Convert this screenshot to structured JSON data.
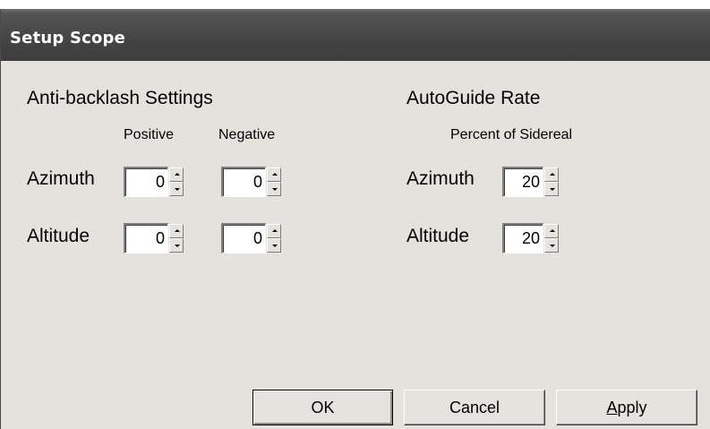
{
  "window": {
    "title": "Setup Scope"
  },
  "anti_backlash": {
    "heading": "Anti-backlash Settings",
    "col_positive": "Positive",
    "col_negative": "Negative",
    "rows": [
      {
        "label": "Azimuth",
        "positive": "0",
        "negative": "0"
      },
      {
        "label": "Altitude",
        "positive": "0",
        "negative": "0"
      }
    ]
  },
  "autoguide": {
    "heading": "AutoGuide Rate",
    "subheading": "Percent of Sidereal",
    "rows": [
      {
        "label": "Azimuth",
        "value": "20"
      },
      {
        "label": "Altitude",
        "value": "20"
      }
    ]
  },
  "buttons": {
    "ok": "OK",
    "cancel": "Cancel",
    "apply": "Apply"
  },
  "icons": {
    "spin_up": "up-arrow-icon",
    "spin_down": "down-arrow-icon"
  }
}
